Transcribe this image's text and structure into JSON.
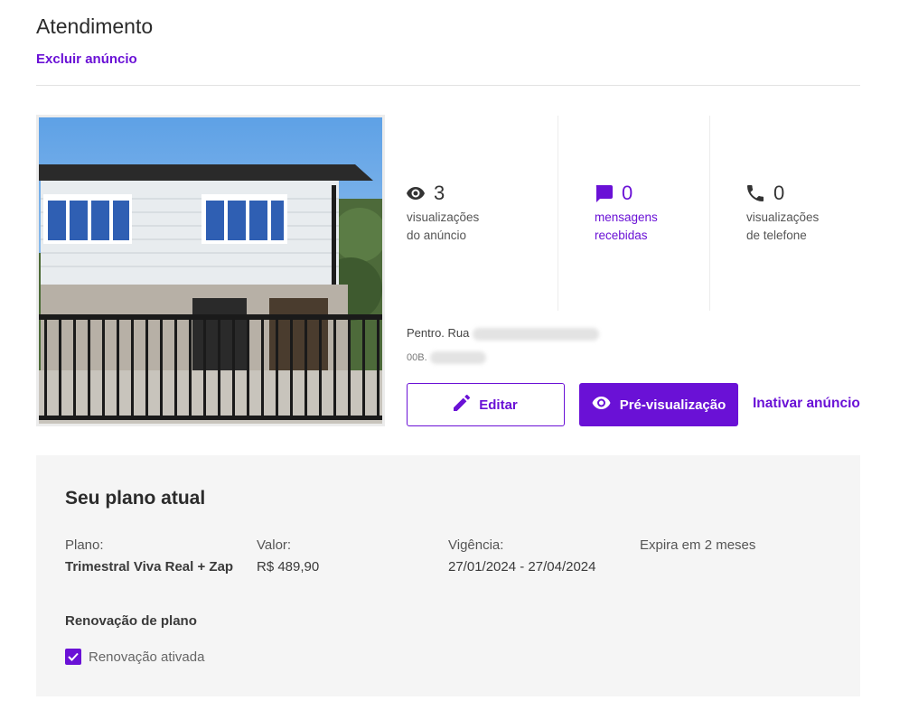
{
  "header": {
    "title": "Atendimento",
    "delete_label": "Excluir anúncio"
  },
  "stats": [
    {
      "icon": "eye-icon",
      "count": "3",
      "label_line1": "visualizações",
      "label_line2": "do anúncio"
    },
    {
      "icon": "message-icon",
      "count": "0",
      "label_line1": "mensagens",
      "label_line2": "recebidas"
    },
    {
      "icon": "phone-icon",
      "count": "0",
      "label_line1": "visualizações",
      "label_line2": "de telefone"
    }
  ],
  "address": {
    "line1": "Pentro. Rua",
    "line2": "00B."
  },
  "actions": {
    "edit_label": "Editar",
    "preview_label": "Pré-visualização",
    "deactivate_label": "Inativar anúncio"
  },
  "plan": {
    "title": "Seu plano atual",
    "plan_label": "Plano:",
    "plan_value": "Trimestral Viva Real + Zap",
    "price_label": "Valor:",
    "price_value": "R$ 489,90",
    "validity_label": "Vigência:",
    "validity_value": "27/01/2024 - 27/04/2024",
    "expires": "Expira em 2 meses",
    "renewal_title": "Renovação de plano",
    "renewal_label": "Renovação ativada",
    "renewal_checked": true
  },
  "colors": {
    "accent": "#6a11d6",
    "panel_bg": "#f5f5f5"
  }
}
